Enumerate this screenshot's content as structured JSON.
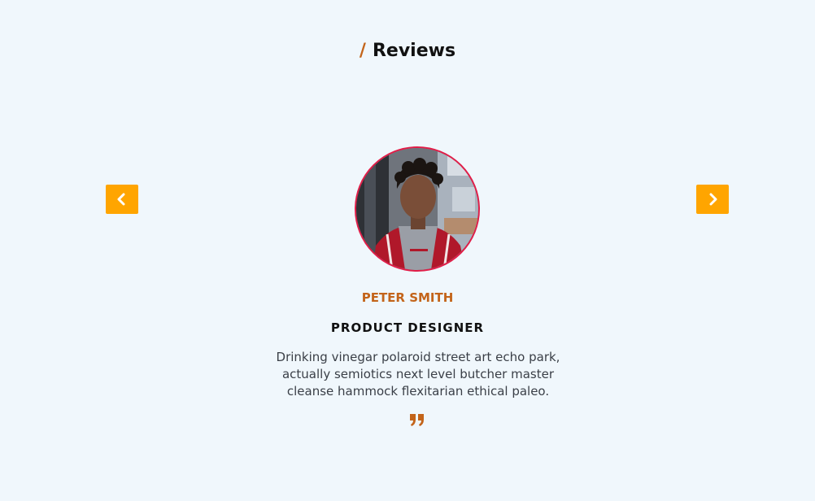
{
  "section": {
    "title_prefix": "/",
    "title": "Reviews"
  },
  "carousel": {
    "prev_icon": "chevron-left-icon",
    "next_icon": "chevron-right-icon"
  },
  "review": {
    "name": "PETER SMITH",
    "role": "PRODUCT DESIGNER",
    "text": "Drinking vinegar polaroid street art echo park, actually semiotics next level butcher master cleanse hammock flexitarian ethical paleo.",
    "quote_icon": "quote-icon"
  },
  "colors": {
    "background": "#f0f7fc",
    "accent": "#c3641a",
    "nav_button": "#ffa500",
    "avatar_border": "#e11d48"
  }
}
